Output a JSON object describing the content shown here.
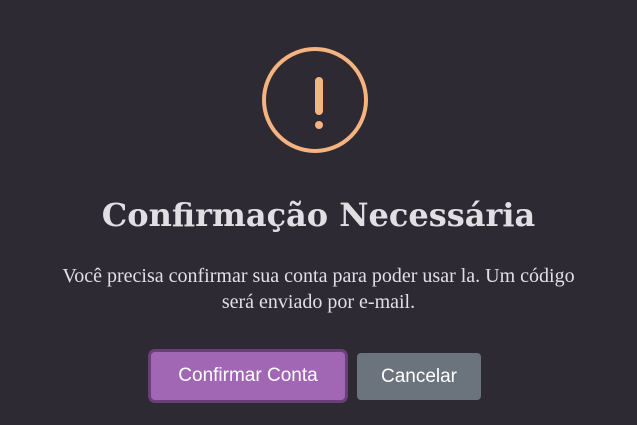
{
  "dialog": {
    "icon": "exclamation-warning-icon",
    "icon_glyph": "!",
    "title": "Confirmação Necessária",
    "message": "Você precisa confirmar sua conta para poder usar la. Um código será enviado por e-mail.",
    "confirm_label": "Confirmar Conta",
    "cancel_label": "Cancelar"
  },
  "colors": {
    "background": "#2d2a33",
    "icon": "#f4b37f",
    "confirm_button": "#a267b4",
    "cancel_button": "#6b747c"
  }
}
